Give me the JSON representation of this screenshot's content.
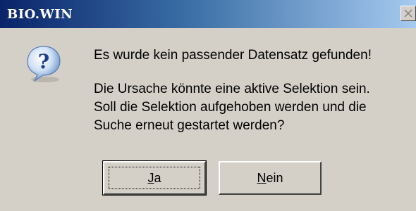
{
  "window": {
    "title": "BIO.WIN"
  },
  "dialog": {
    "icon": "question-icon",
    "message_line1": "Es wurde kein passender Datensatz gefunden!",
    "message_line2": "Die Ursache könnte eine aktive Selektion sein.",
    "message_line3": "Soll die Selektion aufgehoben werden und die",
    "message_line4": "Suche erneut gestartet werden?"
  },
  "buttons": {
    "yes_mnemonic": "J",
    "yes_rest": "a",
    "no_mnemonic": "N",
    "no_rest": "ein"
  },
  "colors": {
    "titlebar_start": "#0a246a",
    "titlebar_end": "#a6caf0",
    "dialog_bg": "#d4d0c8"
  }
}
